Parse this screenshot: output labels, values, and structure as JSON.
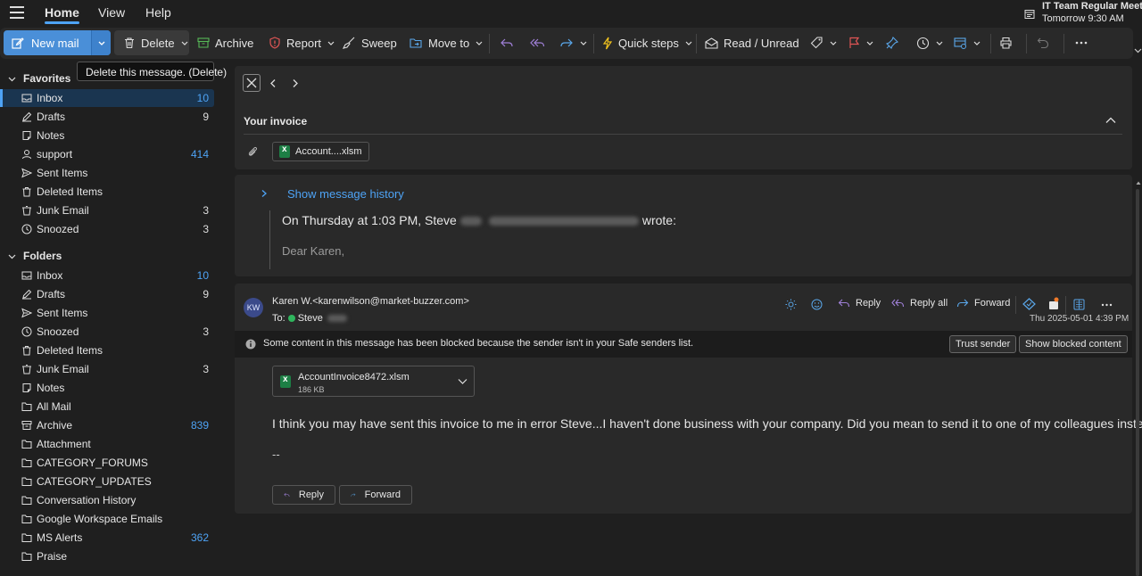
{
  "nav": {
    "tabs": [
      "Home",
      "View",
      "Help"
    ]
  },
  "meeting": {
    "title": "IT Team Regular Meeting",
    "time": "Tomorrow 9:30 AM"
  },
  "ribbon": {
    "new_mail": "New mail",
    "delete": "Delete",
    "archive": "Archive",
    "report": "Report",
    "sweep": "Sweep",
    "move_to": "Move to",
    "quick_steps": "Quick steps",
    "read_unread": "Read / Unread"
  },
  "tooltip": "Delete this message. (Delete)",
  "sidebar": {
    "favorites_label": "Favorites",
    "favorites": [
      {
        "label": "Inbox",
        "count": "10",
        "icon": "inbox-icon"
      },
      {
        "label": "Drafts",
        "count": "9",
        "icon": "pencil-icon"
      },
      {
        "label": "Notes",
        "count": "",
        "icon": "note-icon"
      },
      {
        "label": "support",
        "count": "414",
        "icon": "person-icon"
      },
      {
        "label": "Sent Items",
        "count": "",
        "icon": "send-icon"
      },
      {
        "label": "Deleted Items",
        "count": "",
        "icon": "trash-icon"
      },
      {
        "label": "Junk Email",
        "count": "3",
        "icon": "junk-icon"
      },
      {
        "label": "Snoozed",
        "count": "3",
        "icon": "clock-icon"
      }
    ],
    "folders_label": "Folders",
    "folders": [
      {
        "label": "Inbox",
        "count": "10",
        "icon": "inbox-icon"
      },
      {
        "label": "Drafts",
        "count": "9",
        "icon": "pencil-icon"
      },
      {
        "label": "Sent Items",
        "count": "",
        "icon": "send-icon"
      },
      {
        "label": "Snoozed",
        "count": "3",
        "icon": "clock-icon"
      },
      {
        "label": "Deleted Items",
        "count": "",
        "icon": "trash-icon"
      },
      {
        "label": "Junk Email",
        "count": "3",
        "icon": "junk-icon"
      },
      {
        "label": "Notes",
        "count": "",
        "icon": "note-icon"
      },
      {
        "label": "All Mail",
        "count": "",
        "icon": "folder-icon"
      },
      {
        "label": "Archive",
        "count": "839",
        "icon": "archive-icon"
      },
      {
        "label": "Attachment",
        "count": "",
        "icon": "folder-icon"
      },
      {
        "label": "CATEGORY_FORUMS",
        "count": "",
        "icon": "folder-icon"
      },
      {
        "label": "CATEGORY_UPDATES",
        "count": "",
        "icon": "folder-icon"
      },
      {
        "label": "Conversation History",
        "count": "",
        "icon": "folder-icon"
      },
      {
        "label": "Google Workspace Emails",
        "count": "",
        "icon": "folder-icon"
      },
      {
        "label": "MS Alerts",
        "count": "362",
        "icon": "folder-icon"
      },
      {
        "label": "Praise",
        "count": "",
        "icon": "folder-icon"
      }
    ]
  },
  "thread": {
    "subject": "Your invoice",
    "attachment_chip": "Account....xlsm",
    "show_history": "Show message history",
    "quote_prefix": "On Thursday at 1:03 PM, Steve",
    "quote_suffix": "wrote:",
    "quote_body": "Dear Karen,"
  },
  "message": {
    "avatar_initials": "KW",
    "from": "Karen W.<karenwilson@market-buzzer.com>",
    "to_label": "To:",
    "to_name": "Steve",
    "reply": "Reply",
    "reply_all": "Reply all",
    "forward": "Forward",
    "date": "Thu 2025-05-01 4:39 PM",
    "blocked_notice": "Some content in this message has been blocked because the sender isn't in your Safe senders list.",
    "trust_sender": "Trust sender",
    "show_blocked": "Show blocked content",
    "attachment_name": "AccountInvoice8472.xlsm",
    "attachment_size": "186 KB",
    "body": "I think you may have sent this invoice to me in error Steve...I haven't done business with your company. Did you mean to send it to one of my colleagues instead?",
    "signature": "--",
    "reply_btn": "Reply",
    "forward_btn": "Forward"
  },
  "colors": {
    "accent": "#4ea3f5",
    "new_mail_bg": "#4a8fd8",
    "excel_green": "#1d7f45",
    "selected_bg": "#1a3550"
  }
}
